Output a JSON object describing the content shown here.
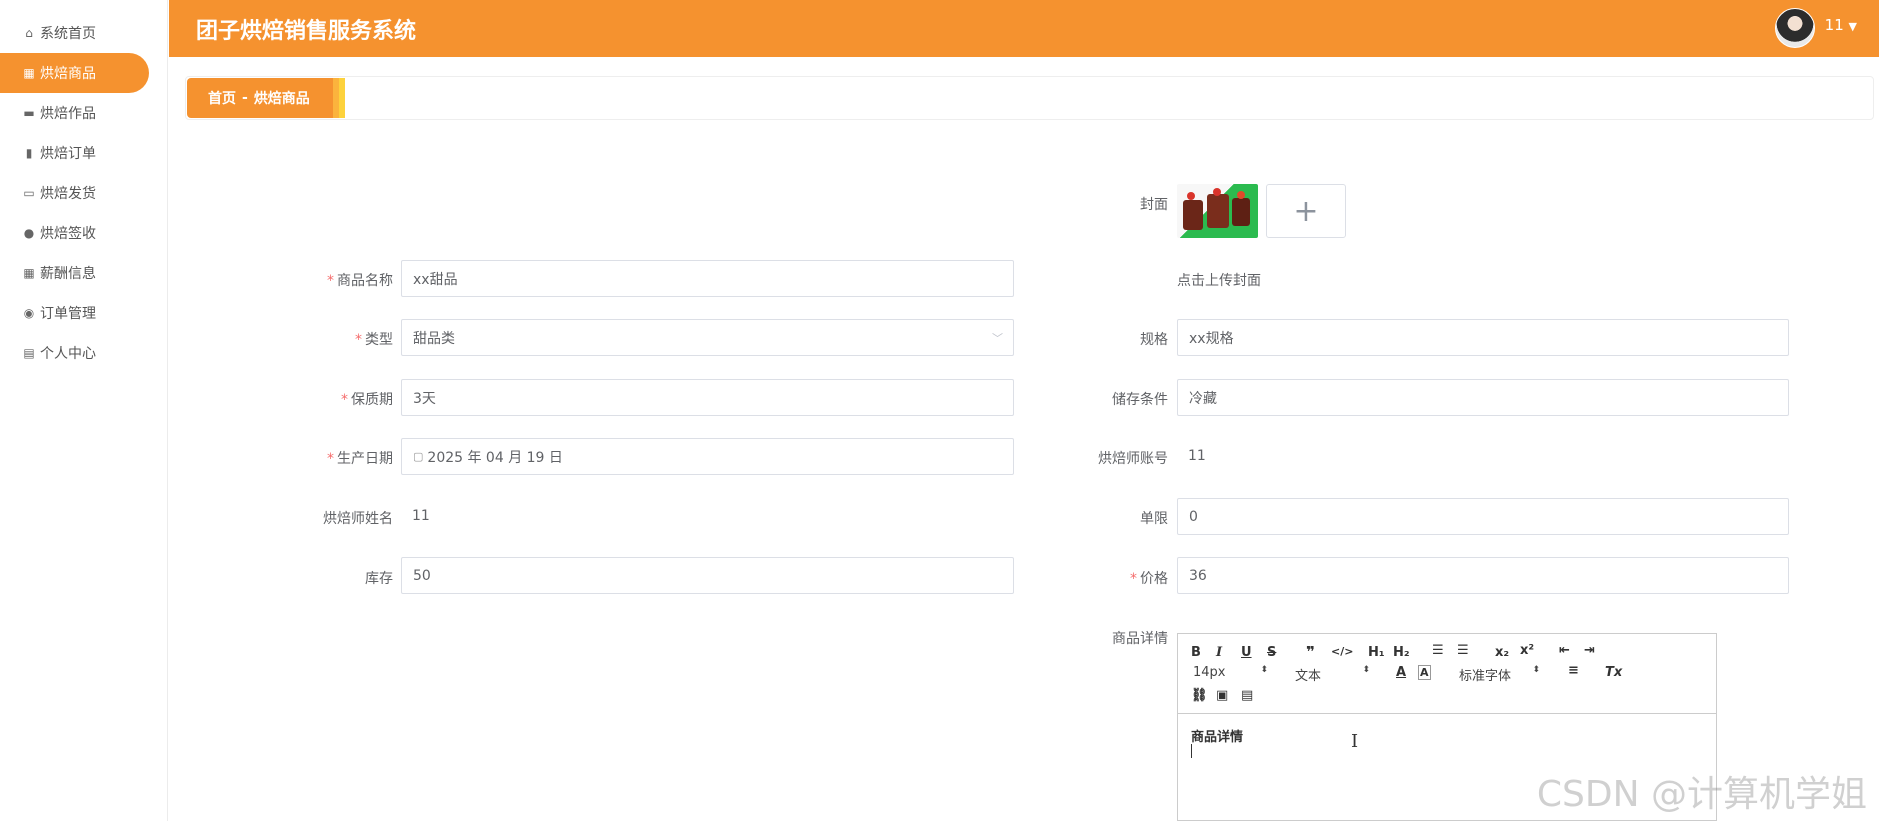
{
  "app": {
    "title": "团子烘焙销售服务系统",
    "user": "11"
  },
  "sidebar": {
    "items": [
      {
        "label": "系统首页",
        "icon": "home-icon"
      },
      {
        "label": "烘焙商品",
        "icon": "grid-icon",
        "active": true
      },
      {
        "label": "烘焙作品",
        "icon": "briefcase-icon"
      },
      {
        "label": "烘焙订单",
        "icon": "clipboard-icon"
      },
      {
        "label": "烘焙发货",
        "icon": "monitor-icon"
      },
      {
        "label": "烘焙签收",
        "icon": "user-icon"
      },
      {
        "label": "薪酬信息",
        "icon": "grid-icon"
      },
      {
        "label": "订单管理",
        "icon": "bulb-icon"
      },
      {
        "label": "个人中心",
        "icon": "card-icon"
      }
    ]
  },
  "breadcrumb": {
    "home": "首页",
    "separator": "-",
    "current": "烘焙商品"
  },
  "form": {
    "cover": {
      "label": "封面",
      "hint": "点击上传封面",
      "add": "+"
    },
    "name": {
      "label": "商品名称",
      "value": "xx甜品"
    },
    "type": {
      "label": "类型",
      "value": "甜品类"
    },
    "shelf_life": {
      "label": "保质期",
      "value": "3天"
    },
    "prod_date": {
      "label": "生产日期",
      "value": "2025 年 04 月 19 日"
    },
    "baker_name": {
      "label": "烘焙师姓名",
      "value": "11"
    },
    "stock": {
      "label": "库存",
      "value": "50"
    },
    "spec": {
      "label": "规格",
      "value": "xx规格"
    },
    "storage": {
      "label": "储存条件",
      "value": "冷藏"
    },
    "baker_account": {
      "label": "烘焙师账号",
      "value": "11"
    },
    "limit": {
      "label": "单限",
      "value": "0"
    },
    "price": {
      "label": "价格",
      "value": "36"
    },
    "detail": {
      "label": "商品详情",
      "content": "商品详情"
    }
  },
  "editor_toolbar": {
    "font_size": "14px",
    "paragraph": "文本",
    "font_family": "标准字体"
  },
  "watermark": "CSDN @计算机学姐",
  "colors": {
    "accent": "#f5922f",
    "required": "#f56c6c"
  }
}
